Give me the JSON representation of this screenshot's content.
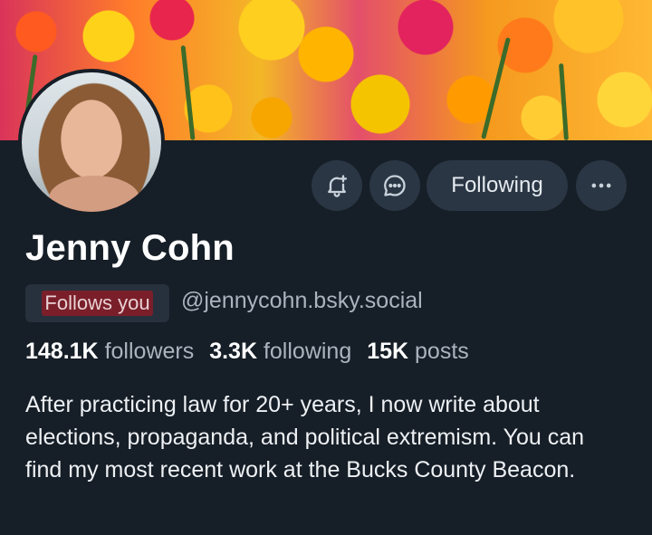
{
  "profile": {
    "name": "Jenny Cohn",
    "follows_you_label": "Follows you",
    "handle": "@jennycohn.bsky.social",
    "stats": {
      "followers_count": "148.1K",
      "followers_label": "followers",
      "following_count": "3.3K",
      "following_label": "following",
      "posts_count": "15K",
      "posts_label": "posts"
    },
    "bio": "After practicing law for 20+ years, I now write about elections, propaganda, and political extremism. You can find my most recent work at the Bucks County Beacon."
  },
  "actions": {
    "notify_icon": "bell-plus-icon",
    "message_icon": "chat-bubble-icon",
    "following_label": "Following",
    "more_icon": "ellipsis-icon"
  },
  "colors": {
    "background": "#161e27",
    "button_bg": "#2a3644",
    "badge_bg": "#27313d",
    "badge_highlight": "#7a1f2a",
    "muted_text": "#aab4bf"
  }
}
